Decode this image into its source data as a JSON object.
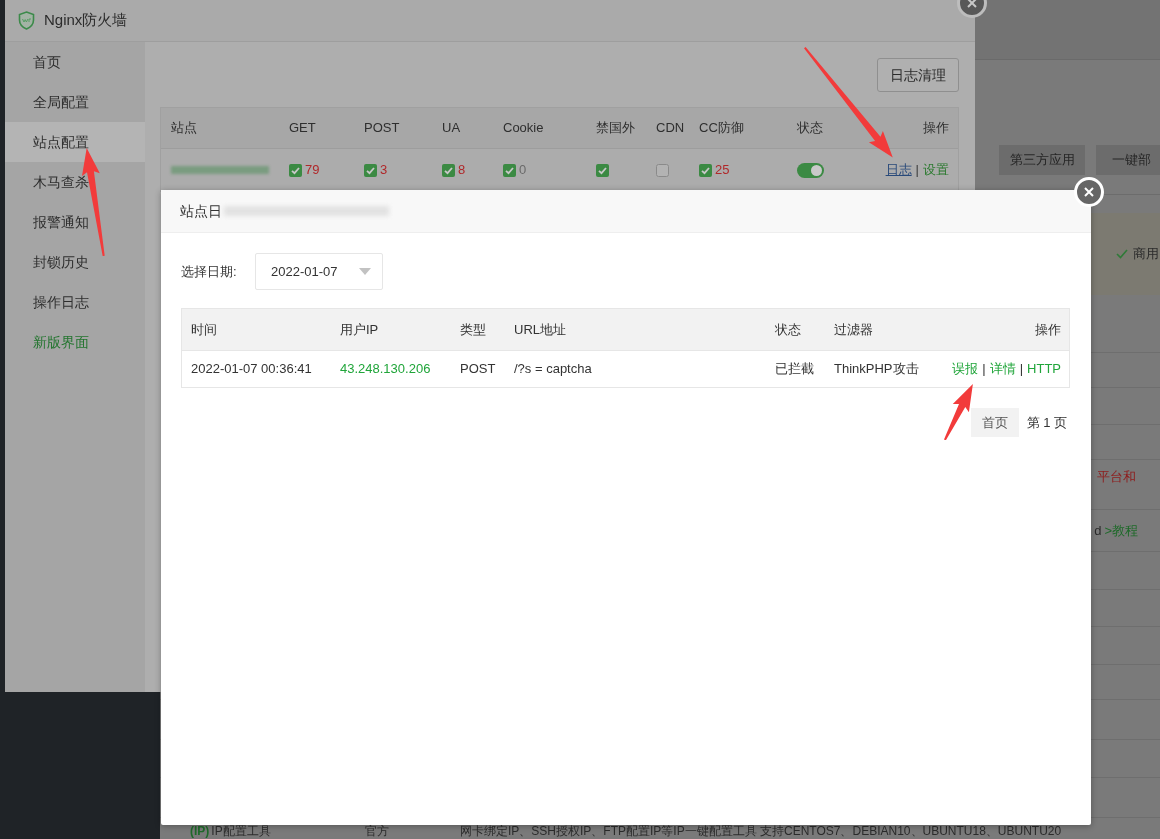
{
  "background_page": {
    "toolbar_buttons": [
      "第三方应用",
      "一键部"
    ],
    "notice": {
      "label": "商用"
    },
    "list_fragments": [
      {
        "kind": "alert",
        "text": "平台和"
      },
      {
        "kind": "link",
        "text": "d",
        "link": ">教程"
      }
    ],
    "bottom_row": {
      "tag": "(IP)",
      "name": "IP配置工具",
      "source": "官方",
      "description": "网卡绑定IP、SSH授权IP、FTP配置IP等IP一键配置工具 支持CENTOS7、DEBIAN10、UBUNTU18、UBUNTU20"
    }
  },
  "firewall_window": {
    "title": "Nginx防火墙",
    "sidebar": [
      {
        "label": "首页",
        "kind": "page",
        "selected": false
      },
      {
        "label": "全局配置",
        "kind": "page",
        "selected": false
      },
      {
        "label": "站点配置",
        "kind": "page",
        "selected": true
      },
      {
        "label": "木马查杀",
        "kind": "page",
        "selected": false
      },
      {
        "label": "报警通知",
        "kind": "page",
        "selected": false
      },
      {
        "label": "封锁历史",
        "kind": "page",
        "selected": false
      },
      {
        "label": "操作日志",
        "kind": "page",
        "selected": false
      },
      {
        "label": "新版界面",
        "kind": "link",
        "selected": false
      }
    ],
    "clear_log_button": "日志清理",
    "table": {
      "columns": [
        "站点",
        "GET",
        "POST",
        "UA",
        "Cookie",
        "禁国外",
        "CDN",
        "CC防御",
        "状态",
        "操作"
      ],
      "rows": [
        {
          "cells": [
            {
              "kind": "redacted"
            },
            {
              "kind": "check_count",
              "checked": true,
              "count": "79",
              "color": "#b0282a"
            },
            {
              "kind": "check_count",
              "checked": true,
              "count": "3",
              "color": "#b0282a"
            },
            {
              "kind": "check_count",
              "checked": true,
              "count": "8",
              "color": "#b0282a"
            },
            {
              "kind": "check_count",
              "checked": true,
              "count": "0",
              "color": "#6a6a6a"
            },
            {
              "kind": "check",
              "checked": true
            },
            {
              "kind": "check",
              "checked": false
            },
            {
              "kind": "check_count",
              "checked": true,
              "count": "25",
              "color": "#b0282a"
            },
            {
              "kind": "toggle",
              "on": true
            },
            {
              "kind": "links",
              "separator": "|",
              "links": [
                {
                  "label": "日志",
                  "color": "#28497a",
                  "underlined": true
                },
                {
                  "label": "设置",
                  "color": "#2b7a2f",
                  "underlined": false
                }
              ]
            }
          ]
        }
      ]
    }
  },
  "modal": {
    "title": "站点日",
    "date_label": "选择日期:",
    "date_value": "2022-01-07",
    "table": {
      "columns": [
        "时间",
        "用户IP",
        "类型",
        "URL地址",
        "状态",
        "过滤器",
        "操作"
      ],
      "rows": [
        {
          "time": "2022-01-07 00:36:41",
          "ip": "43.248.130.206",
          "type": "POST",
          "url": "/?s = captcha",
          "status": "已拦截",
          "filter": "ThinkPHP攻击",
          "separator": "|",
          "actions": [
            "误报",
            "详情",
            "HTTP"
          ]
        }
      ]
    },
    "pagination": {
      "first_button": "首页",
      "page_label": "第 1 页"
    }
  }
}
